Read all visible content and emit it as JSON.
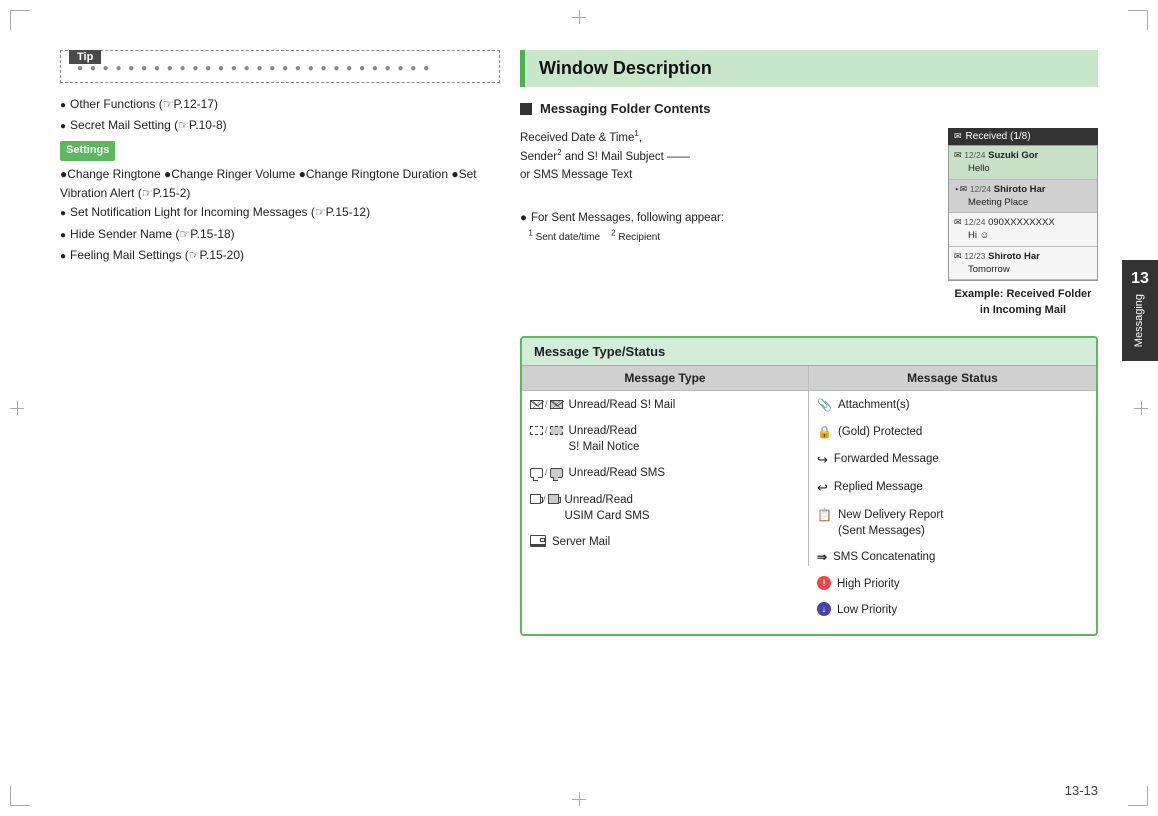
{
  "page": {
    "number": "13-13",
    "chapter": {
      "num": "13",
      "label": "Messaging"
    }
  },
  "left": {
    "tip_label": "Tip",
    "tip_dots": "● ● ● ● ● ● ● ● ● ● ● ● ● ● ● ● ● ● ● ● ● ● ● ● ● ● ● ●",
    "bullets": [
      "Other Functions (☞P.12-17)",
      "Secret Mail Setting (☞P.10-8)"
    ],
    "settings_label": "Settings",
    "settings_bullets": [
      "Change Ringtone ●Change Ringer Volume ●Change Ringtone Duration ●Set Vibration Alert (☞P.15-2)",
      "Set Notification Light for Incoming Messages (☞P.15-12)",
      "Hide Sender Name (☞P.15-18)",
      "Feeling Mail Settings (☞P.15-20)"
    ]
  },
  "right": {
    "window_title": "Window Description",
    "section_title": "Messaging Folder Contents",
    "folder_desc_line1": "Received Date & Time",
    "folder_desc_sup1": "1",
    "folder_desc_line2": "Sender",
    "folder_desc_sup2": "2",
    "folder_desc_line3": " and S! Mail Subject",
    "folder_desc_line4": "or SMS Message Text",
    "sent_note_intro": "● For Sent Messages, following appear:",
    "sent_note_1": "1 Sent date/time",
    "sent_note_2": "2 Recipient",
    "phone_header": "Received (1/8)",
    "phone_rows": [
      {
        "date": "12/24",
        "sender": "Suzuki Gor",
        "text": "Hello",
        "selected": true
      },
      {
        "date": "12/24",
        "sender": "Shiroto Har",
        "text": "Meeting Place",
        "selected": false,
        "starred": true
      },
      {
        "date": "12/24",
        "text": "090XXXXXXXX Hi ☺",
        "selected": false
      },
      {
        "date": "12/23",
        "sender": "Shiroto Har",
        "text": "Tomorrow",
        "selected": false
      }
    ],
    "phone_caption": "Example: Received Folder\nin Incoming Mail",
    "msg_type_title": "Message Type/Status",
    "col_type_header": "Message Type",
    "col_status_header": "Message Status",
    "type_rows": [
      {
        "icons": "✉/✉",
        "label": "Unread/Read S! Mail"
      },
      {
        "icons": "✉/✉",
        "label": "Unread/Read\nS! Mail Notice"
      },
      {
        "icons": "💬/💬",
        "label": "Unread/Read SMS"
      },
      {
        "icons": "📟/📟",
        "label": "Unread/Read\nUSIM Card SMS"
      },
      {
        "icons": "🖥",
        "label": "Server Mail"
      }
    ],
    "status_rows": [
      {
        "icon": "📎",
        "label": "Attachment(s)"
      },
      {
        "icon": "🔒",
        "label": "(Gold) Protected"
      },
      {
        "icon": "↪",
        "label": "Forwarded Message"
      },
      {
        "icon": "↩",
        "label": "Replied Message"
      },
      {
        "icon": "📋",
        "label": "New Delivery Report\n(Sent Messages)"
      },
      {
        "icon": "➡",
        "label": "SMS Concatenating"
      },
      {
        "icon": "🔴",
        "label": "High Priority"
      },
      {
        "icon": "🔵",
        "label": "Low Priority"
      }
    ]
  }
}
